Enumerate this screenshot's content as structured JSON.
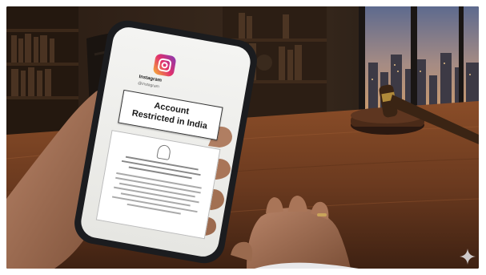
{
  "phone": {
    "app_icon": "instagram-icon",
    "profile_handle": "Instagram",
    "profile_sub": "@instagram",
    "notice_line1": "Account",
    "notice_line2": "Restricted in India",
    "emblem_icon": "indian-emblem-icon"
  },
  "watermark_icon": "sparkle-icon",
  "colors": {
    "wood": "#6b3a1f",
    "shelf": "#2a1d14",
    "window_sky": "#7b7f95",
    "gavel": "#3a2414"
  }
}
